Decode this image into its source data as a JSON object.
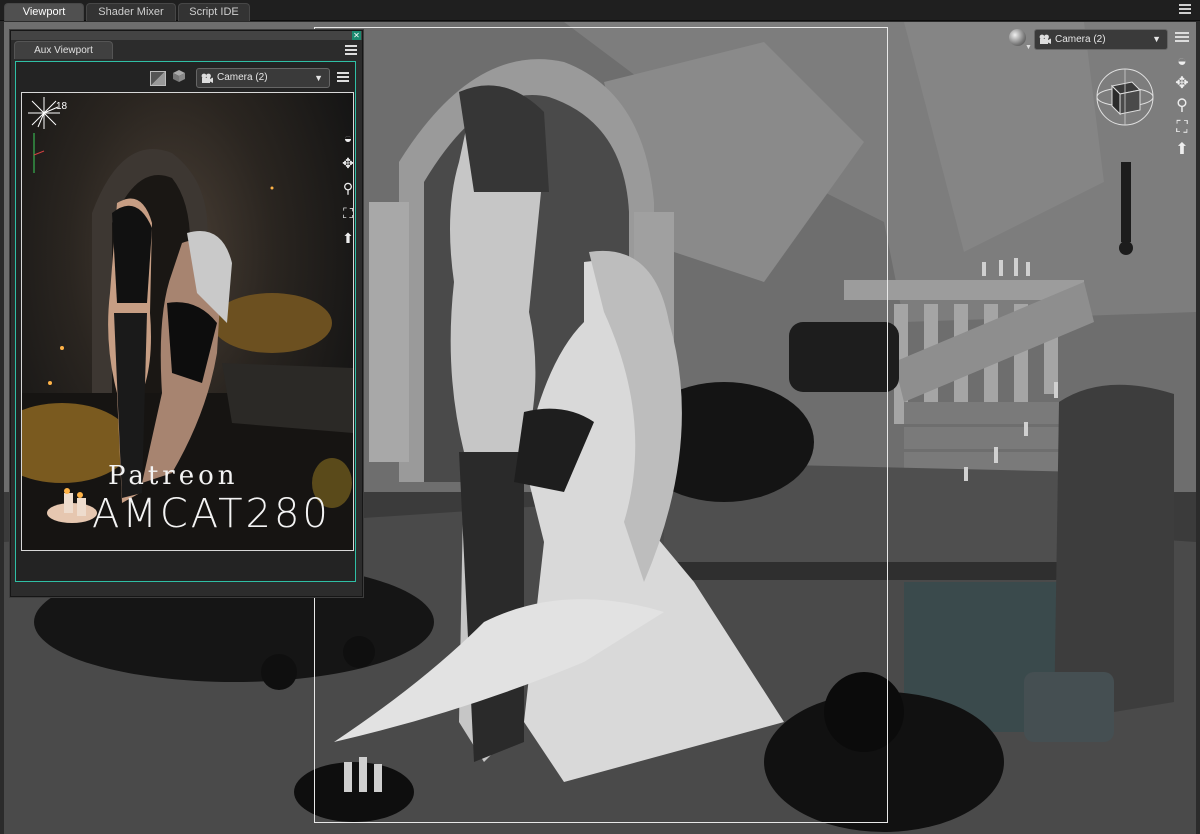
{
  "tabs": [
    {
      "label": "Viewport",
      "active": true
    },
    {
      "label": "Shader Mixer",
      "active": false
    },
    {
      "label": "Script IDE",
      "active": false
    }
  ],
  "viewport": {
    "camera_label": "Camera (2)",
    "tools": [
      "orbit-icon",
      "pan-icon",
      "zoom-icon",
      "frame-icon",
      "home-icon"
    ]
  },
  "aux_viewport": {
    "tab_label": "Aux Viewport",
    "camera_label": "Camera (2)",
    "frame_count": "18",
    "watermark_line1": "Patreon",
    "watermark_line2": "AMCAT280",
    "tools": [
      "orbit-icon",
      "pan-icon",
      "zoom-icon",
      "frame-icon",
      "home-icon"
    ]
  },
  "colors": {
    "accent": "#2fbfa5",
    "chrome_bg": "#2b2b2b",
    "tab_active": "#505050"
  }
}
